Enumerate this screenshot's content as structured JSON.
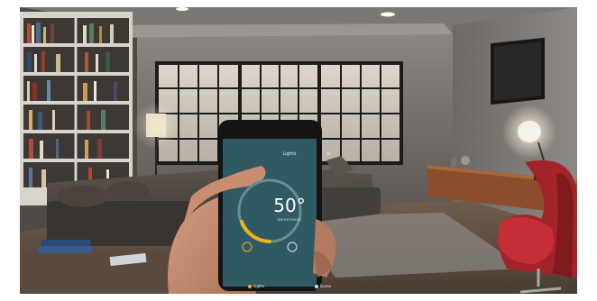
{
  "phone": {
    "screen_title": "Lights",
    "dial_value": "50°",
    "dial_label": "BRIGHTNESS",
    "tabs": [
      {
        "label": "Lights",
        "icon": "bulb-icon"
      },
      {
        "label": "Scene",
        "icon": "scene-icon"
      }
    ]
  },
  "colors": {
    "screen_bg": "#2f5a63",
    "dial_arc": "#f2b21a",
    "dial_track": "#6b8c92"
  }
}
